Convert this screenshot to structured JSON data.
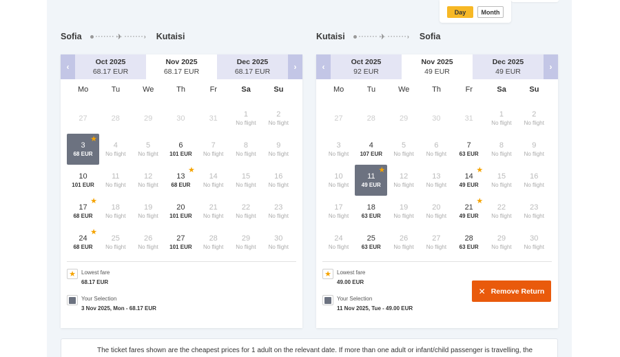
{
  "view_toggle": {
    "day_label": "Day",
    "month_label": "Month"
  },
  "outbound": {
    "from": "Sofia",
    "to": "Kutaisi",
    "months": [
      {
        "name": "Oct 2025",
        "price": "68.17 EUR"
      },
      {
        "name": "Nov 2025",
        "price": "68.17 EUR"
      },
      {
        "name": "Dec 2025",
        "price": "68.17 EUR"
      }
    ],
    "weekdays": [
      "Mo",
      "Tu",
      "We",
      "Th",
      "Fr",
      "Sa",
      "Su"
    ],
    "weeks": [
      [
        {
          "d": "27",
          "p": "",
          "t": "empty"
        },
        {
          "d": "28",
          "p": "",
          "t": "empty"
        },
        {
          "d": "29",
          "p": "",
          "t": "empty"
        },
        {
          "d": "30",
          "p": "",
          "t": "empty"
        },
        {
          "d": "31",
          "p": "",
          "t": "empty"
        },
        {
          "d": "1",
          "p": "No flight",
          "t": "nf"
        },
        {
          "d": "2",
          "p": "No flight",
          "t": "nf"
        }
      ],
      [
        {
          "d": "3",
          "p": "68 EUR",
          "t": "sel",
          "star": true
        },
        {
          "d": "4",
          "p": "No flight",
          "t": "nf"
        },
        {
          "d": "5",
          "p": "No flight",
          "t": "nf"
        },
        {
          "d": "6",
          "p": "101 EUR",
          "t": "av"
        },
        {
          "d": "7",
          "p": "No flight",
          "t": "nf"
        },
        {
          "d": "8",
          "p": "No flight",
          "t": "nf"
        },
        {
          "d": "9",
          "p": "No flight",
          "t": "nf"
        }
      ],
      [
        {
          "d": "10",
          "p": "101 EUR",
          "t": "av"
        },
        {
          "d": "11",
          "p": "No flight",
          "t": "nf"
        },
        {
          "d": "12",
          "p": "No flight",
          "t": "nf"
        },
        {
          "d": "13",
          "p": "68 EUR",
          "t": "av",
          "star": true
        },
        {
          "d": "14",
          "p": "No flight",
          "t": "nf"
        },
        {
          "d": "15",
          "p": "No flight",
          "t": "nf"
        },
        {
          "d": "16",
          "p": "No flight",
          "t": "nf"
        }
      ],
      [
        {
          "d": "17",
          "p": "68 EUR",
          "t": "av",
          "star": true
        },
        {
          "d": "18",
          "p": "No flight",
          "t": "nf"
        },
        {
          "d": "19",
          "p": "No flight",
          "t": "nf"
        },
        {
          "d": "20",
          "p": "101 EUR",
          "t": "av"
        },
        {
          "d": "21",
          "p": "No flight",
          "t": "nf"
        },
        {
          "d": "22",
          "p": "No flight",
          "t": "nf"
        },
        {
          "d": "23",
          "p": "No flight",
          "t": "nf"
        }
      ],
      [
        {
          "d": "24",
          "p": "68 EUR",
          "t": "av",
          "star": true
        },
        {
          "d": "25",
          "p": "No flight",
          "t": "nf"
        },
        {
          "d": "26",
          "p": "No flight",
          "t": "nf"
        },
        {
          "d": "27",
          "p": "101 EUR",
          "t": "av"
        },
        {
          "d": "28",
          "p": "No flight",
          "t": "nf"
        },
        {
          "d": "29",
          "p": "No flight",
          "t": "nf"
        },
        {
          "d": "30",
          "p": "No flight",
          "t": "nf"
        }
      ]
    ],
    "legend": {
      "lowest_label": "Lowest fare",
      "lowest_value": "68.17 EUR",
      "selection_label": "Your Selection",
      "selection_value": "3 Nov 2025, Mon - 68.17 EUR"
    }
  },
  "return": {
    "from": "Kutaisi",
    "to": "Sofia",
    "months": [
      {
        "name": "Oct 2025",
        "price": "92 EUR"
      },
      {
        "name": "Nov 2025",
        "price": "49 EUR"
      },
      {
        "name": "Dec 2025",
        "price": "49 EUR"
      }
    ],
    "weekdays": [
      "Mo",
      "Tu",
      "We",
      "Th",
      "Fr",
      "Sa",
      "Su"
    ],
    "weeks": [
      [
        {
          "d": "27",
          "p": "",
          "t": "empty"
        },
        {
          "d": "28",
          "p": "",
          "t": "empty"
        },
        {
          "d": "29",
          "p": "",
          "t": "empty"
        },
        {
          "d": "30",
          "p": "",
          "t": "empty"
        },
        {
          "d": "31",
          "p": "",
          "t": "empty"
        },
        {
          "d": "1",
          "p": "No flight",
          "t": "nf"
        },
        {
          "d": "2",
          "p": "No flight",
          "t": "nf"
        }
      ],
      [
        {
          "d": "3",
          "p": "No flight",
          "t": "nf"
        },
        {
          "d": "4",
          "p": "107 EUR",
          "t": "av"
        },
        {
          "d": "5",
          "p": "No flight",
          "t": "nf"
        },
        {
          "d": "6",
          "p": "No flight",
          "t": "nf"
        },
        {
          "d": "7",
          "p": "63 EUR",
          "t": "av"
        },
        {
          "d": "8",
          "p": "No flight",
          "t": "nf"
        },
        {
          "d": "9",
          "p": "No flight",
          "t": "nf"
        }
      ],
      [
        {
          "d": "10",
          "p": "No flight",
          "t": "nf"
        },
        {
          "d": "11",
          "p": "49 EUR",
          "t": "sel",
          "star": true
        },
        {
          "d": "12",
          "p": "No flight",
          "t": "nf"
        },
        {
          "d": "13",
          "p": "No flight",
          "t": "nf"
        },
        {
          "d": "14",
          "p": "49 EUR",
          "t": "av",
          "star": true
        },
        {
          "d": "15",
          "p": "No flight",
          "t": "nf"
        },
        {
          "d": "16",
          "p": "No flight",
          "t": "nf"
        }
      ],
      [
        {
          "d": "17",
          "p": "No flight",
          "t": "nf"
        },
        {
          "d": "18",
          "p": "63 EUR",
          "t": "av"
        },
        {
          "d": "19",
          "p": "No flight",
          "t": "nf"
        },
        {
          "d": "20",
          "p": "No flight",
          "t": "nf"
        },
        {
          "d": "21",
          "p": "49 EUR",
          "t": "av",
          "star": true
        },
        {
          "d": "22",
          "p": "No flight",
          "t": "nf"
        },
        {
          "d": "23",
          "p": "No flight",
          "t": "nf"
        }
      ],
      [
        {
          "d": "24",
          "p": "No flight",
          "t": "nf"
        },
        {
          "d": "25",
          "p": "63 EUR",
          "t": "av"
        },
        {
          "d": "26",
          "p": "No flight",
          "t": "nf"
        },
        {
          "d": "27",
          "p": "No flight",
          "t": "nf"
        },
        {
          "d": "28",
          "p": "63 EUR",
          "t": "av"
        },
        {
          "d": "29",
          "p": "No flight",
          "t": "nf"
        },
        {
          "d": "30",
          "p": "No flight",
          "t": "nf"
        }
      ]
    ],
    "legend": {
      "lowest_label": "Lowest fare",
      "lowest_value": "49.00 EUR",
      "selection_label": "Your Selection",
      "selection_value": "11 Nov 2025, Tue - 49.00 EUR"
    },
    "remove_label": "Remove Return"
  },
  "note": "The ticket fares shown are the cheapest prices for 1 adult on the relevant date. If more than one adult or infant/child passenger is travelling, the",
  "colors": {
    "accent": "#f7b825",
    "selected": "#6c7280",
    "remove": "#e95a0c",
    "arrow": "#c3c6e6"
  }
}
